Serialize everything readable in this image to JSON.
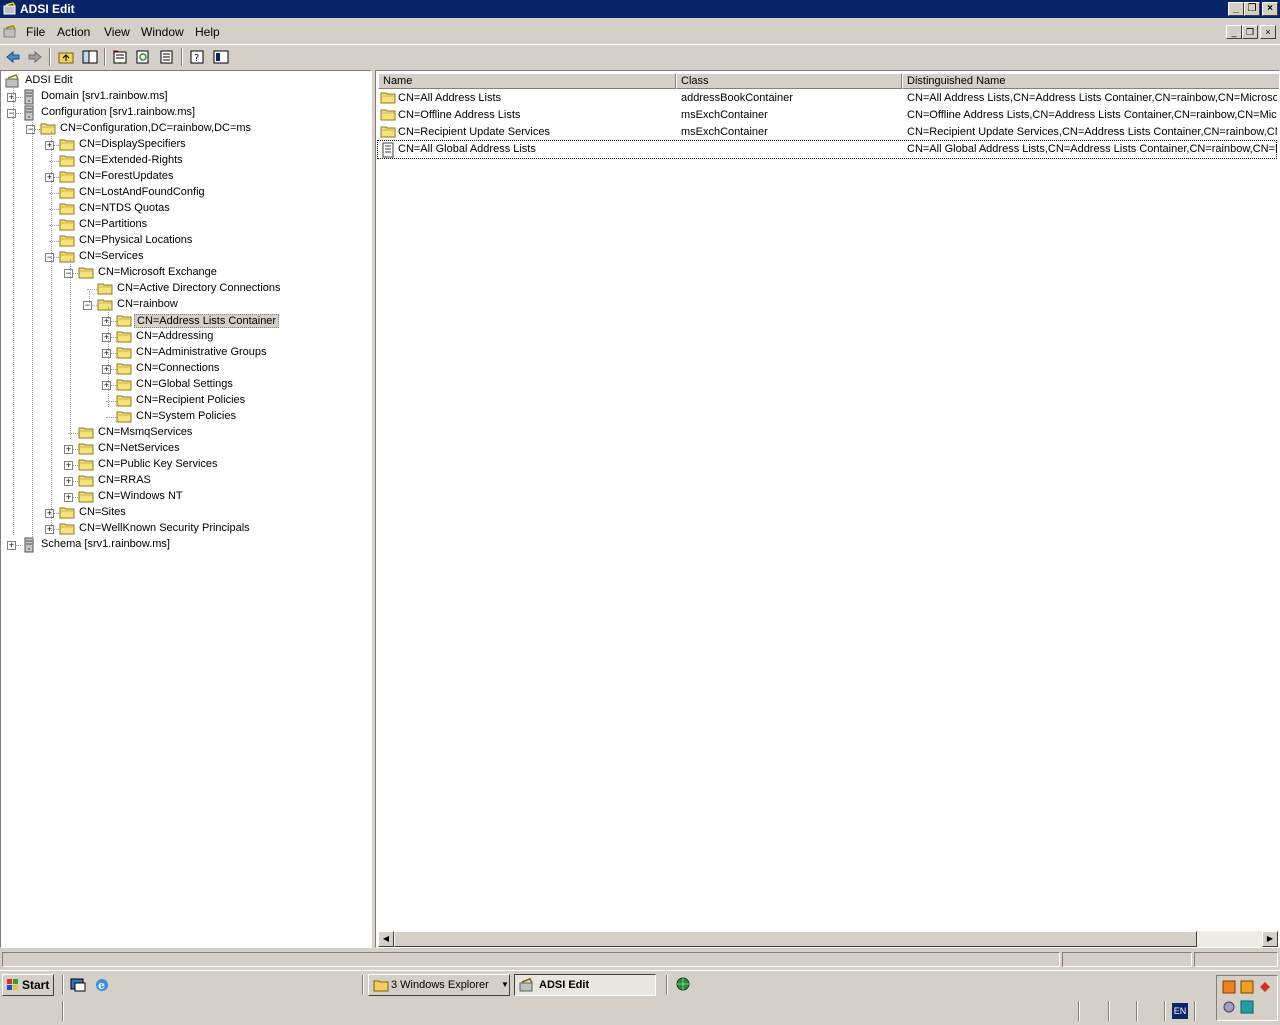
{
  "window": {
    "title": "ADSI Edit",
    "icon": "adsi-edit-icon"
  },
  "menu": {
    "file": "File",
    "action": "Action",
    "view": "View",
    "window": "Window",
    "help": "Help"
  },
  "toolbar": {
    "buttons": [
      "back-arrow-icon",
      "forward-arrow-icon",
      "up-folder-icon",
      "show-tree-icon",
      "properties-icon",
      "refresh-icon",
      "export-list-icon",
      "help-icon",
      "console-icon"
    ]
  },
  "tree": {
    "root": "ADSI Edit",
    "nodes": [
      "Domain [srv1.rainbow.ms]",
      "Configuration [srv1.rainbow.ms]",
      "CN=Configuration,DC=rainbow,DC=ms",
      "CN=DisplaySpecifiers",
      "CN=Extended-Rights",
      "CN=ForestUpdates",
      "CN=LostAndFoundConfig",
      "CN=NTDS Quotas",
      "CN=Partitions",
      "CN=Physical Locations",
      "CN=Services",
      "CN=Microsoft Exchange",
      "CN=Active Directory Connections",
      "CN=rainbow",
      "CN=Address Lists Container",
      "CN=Addressing",
      "CN=Administrative Groups",
      "CN=Connections",
      "CN=Global Settings",
      "CN=Recipient Policies",
      "CN=System Policies",
      "CN=MsmqServices",
      "CN=NetServices",
      "CN=Public Key Services",
      "CN=RRAS",
      "CN=Windows NT",
      "CN=Sites",
      "CN=WellKnown Security Principals",
      "Schema [srv1.rainbow.ms]"
    ]
  },
  "list": {
    "columns": [
      "Name",
      "Class",
      "Distinguished Name"
    ],
    "rows": [
      {
        "name": "CN=All Address Lists",
        "class": "addressBookContainer",
        "dn": "CN=All Address Lists,CN=Address Lists Container,CN=rainbow,CN=Microsoft"
      },
      {
        "name": "CN=Offline Address Lists",
        "class": "msExchContainer",
        "dn": "CN=Offline Address Lists,CN=Address Lists Container,CN=rainbow,CN=Micro"
      },
      {
        "name": "CN=Recipient Update Services",
        "class": "msExchContainer",
        "dn": "CN=Recipient Update Services,CN=Address Lists Container,CN=rainbow,CN="
      },
      {
        "name": "CN=All Global Address Lists",
        "class": "",
        "dn": "CN=All Global Address Lists,CN=Address Lists Container,CN=rainbow,CN=Mi"
      }
    ]
  },
  "taskbar": {
    "start": "Start",
    "explorer": "3 Windows Explorer",
    "adsi": "ADSI Edit",
    "lang": "EN"
  }
}
